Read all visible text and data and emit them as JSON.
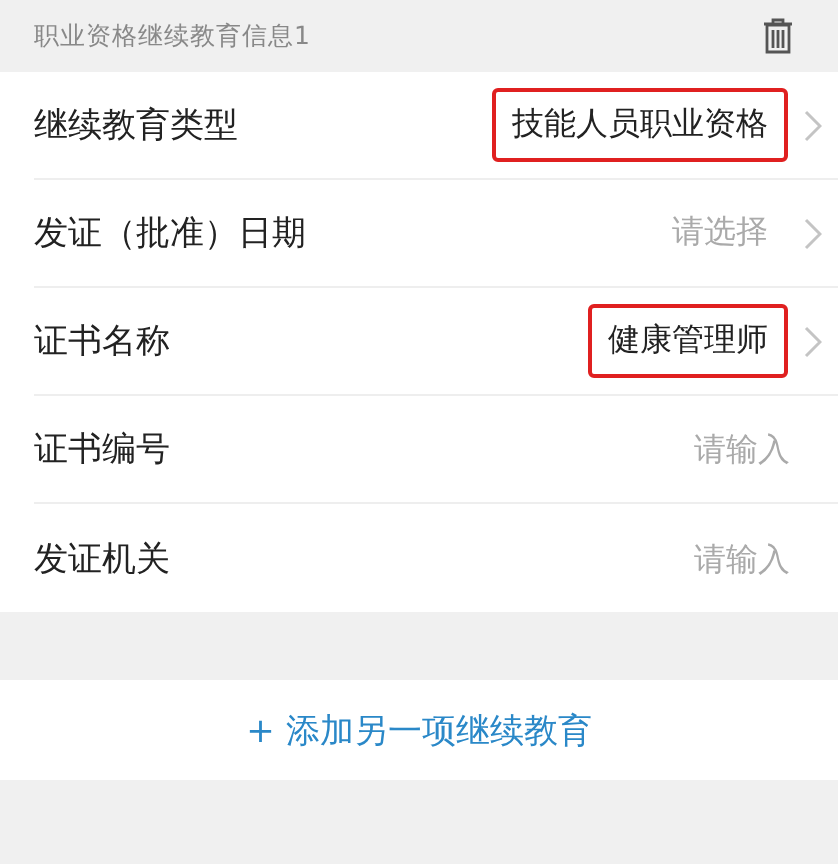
{
  "section": {
    "title": "职业资格继续教育信息1"
  },
  "fields": [
    {
      "kind": "select",
      "label": "继续教育类型",
      "value": "技能人员职业资格",
      "highlighted": true
    },
    {
      "kind": "select",
      "label": "发证（批准）日期",
      "placeholder": "请选择",
      "highlighted": false
    },
    {
      "kind": "select",
      "label": "证书名称",
      "value": "健康管理师",
      "highlighted": true
    },
    {
      "kind": "input",
      "label": "证书编号",
      "placeholder": "请输入",
      "highlighted": false
    },
    {
      "kind": "input",
      "label": "发证机关",
      "placeholder": "请输入",
      "highlighted": false
    }
  ],
  "add_button": {
    "label": "+ 添加另一项继续教育"
  }
}
